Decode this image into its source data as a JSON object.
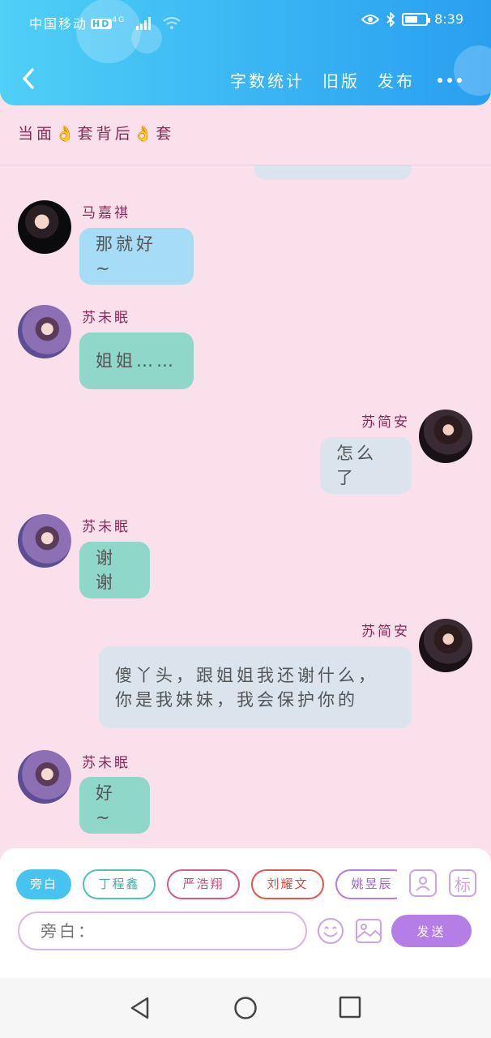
{
  "status_bar": {
    "carrier": "中国移动",
    "hd": "HD",
    "network": "4G",
    "time": "8:39"
  },
  "nav": {
    "word_count": "字数统计",
    "old_version": "旧版",
    "publish": "发布"
  },
  "chat_title": "当面👌套背后👌套",
  "messages": [
    {
      "sender": "马嘉祺",
      "text": "那就好 ~",
      "side": "left"
    },
    {
      "sender": "苏未眠",
      "text": "姐姐……",
      "side": "left"
    },
    {
      "sender": "苏简安",
      "text": "怎么了",
      "side": "right"
    },
    {
      "sender": "苏未眠",
      "text": "谢谢",
      "side": "left"
    },
    {
      "sender": "苏简安",
      "text": "傻丫头，跟姐姐我还谢什么，\n你是我妹妹，我会保护你的",
      "side": "right"
    },
    {
      "sender": "苏未眠",
      "text": "好 ~",
      "side": "left"
    }
  ],
  "role_chips": [
    {
      "label": "旁白",
      "color": "#46c3ef"
    },
    {
      "label": "丁程鑫",
      "color": "#4fc3b3"
    },
    {
      "label": "严浩翔",
      "color": "#d65a8e"
    },
    {
      "label": "刘耀文",
      "color": "#e0584f"
    },
    {
      "label": "姚昱辰",
      "color": "#b57de6"
    }
  ],
  "tools": {
    "tag_label": "标"
  },
  "composer": {
    "placeholder": "旁白：",
    "send_label": "发送"
  }
}
